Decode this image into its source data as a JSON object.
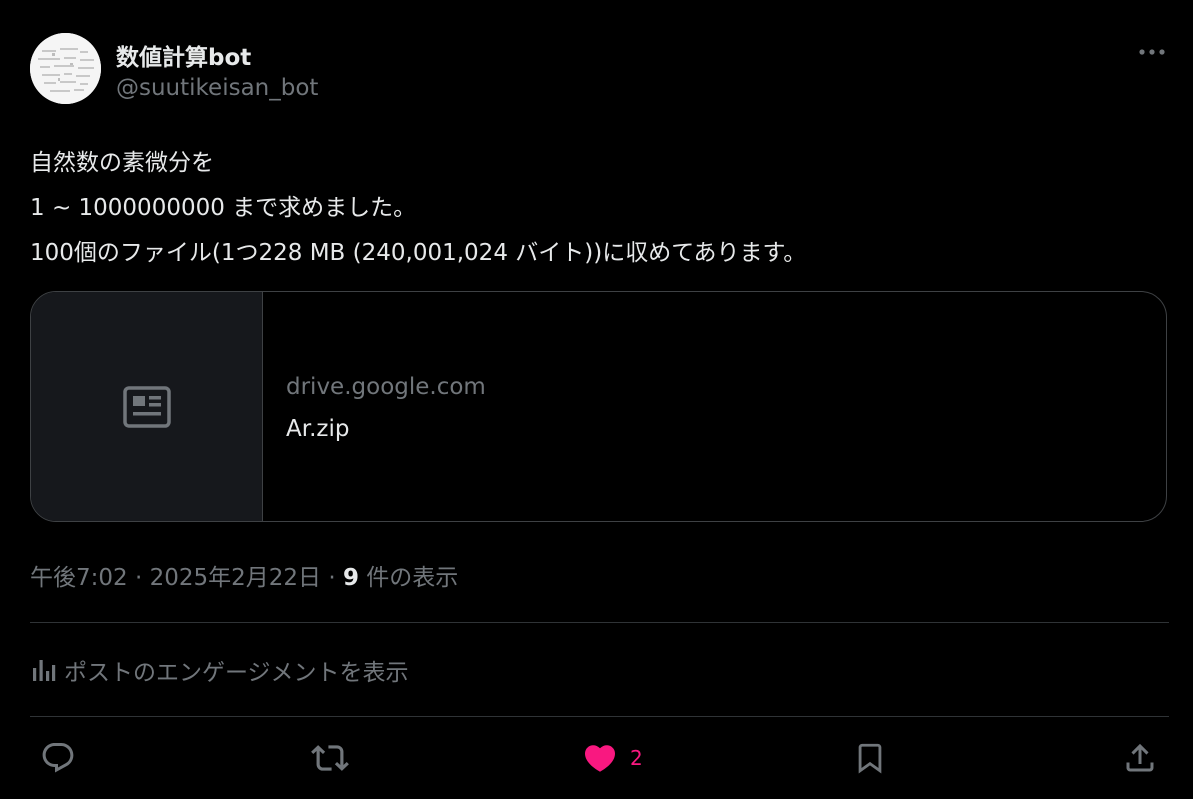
{
  "author": {
    "name": "数値計算bot",
    "handle": "@suutikeisan_bot"
  },
  "tweet": {
    "lines": [
      "自然数の素微分を",
      "1 ~ 1000000000 まで求めました。",
      "100個のファイル(1つ228 MB (240,001,024 バイト))に収めてあります。"
    ]
  },
  "card": {
    "icon": "article-icon",
    "domain": "drive.google.com",
    "title": "Ar.zip"
  },
  "meta": {
    "time": "午後7:02",
    "sep1": " · ",
    "date": "2025年2月22日",
    "sep2": " · ",
    "views_count": "9",
    "views_label": " 件の表示"
  },
  "engagement": {
    "label": "ポストのエンゲージメントを表示",
    "icon": "analytics-icon"
  },
  "actions": {
    "reply_icon": "reply-icon",
    "repost_icon": "repost-icon",
    "like_icon": "heart-icon",
    "like_count": "2",
    "bookmark_icon": "bookmark-icon",
    "share_icon": "share-icon"
  },
  "colors": {
    "background": "#000000",
    "text": "#e7e9ea",
    "secondary": "#71767b",
    "like": "#f91880",
    "border": "#2f3336"
  }
}
